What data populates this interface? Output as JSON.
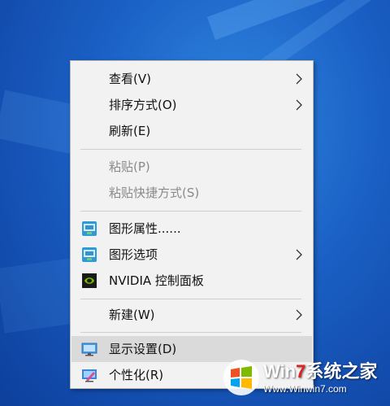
{
  "context_menu": {
    "items": [
      {
        "label": "查看(V)",
        "submenu": true,
        "enabled": true
      },
      {
        "label": "排序方式(O)",
        "submenu": true,
        "enabled": true
      },
      {
        "label": "刷新(E)",
        "submenu": false,
        "enabled": true
      },
      {
        "label": "粘贴(P)",
        "submenu": false,
        "enabled": false
      },
      {
        "label": "粘贴快捷方式(S)",
        "submenu": false,
        "enabled": false
      },
      {
        "label": "图形属性......",
        "submenu": false,
        "enabled": true,
        "icon": "intel-graphics-icon"
      },
      {
        "label": "图形选项",
        "submenu": true,
        "enabled": true,
        "icon": "intel-graphics-icon"
      },
      {
        "label": "NVIDIA 控制面板",
        "submenu": false,
        "enabled": true,
        "icon": "nvidia-icon"
      },
      {
        "label": "新建(W)",
        "submenu": true,
        "enabled": true
      },
      {
        "label": "显示设置(D)",
        "submenu": false,
        "enabled": true,
        "icon": "monitor-icon",
        "highlighted": true
      },
      {
        "label": "个性化(R)",
        "submenu": false,
        "enabled": true,
        "icon": "personalize-icon"
      }
    ]
  },
  "watermark": {
    "title_part1": "Win",
    "title_accent": "7",
    "title_part2": "系统之家",
    "url": "Www.Winwin7.com"
  },
  "colors": {
    "menu_bg": "#f2f2f2",
    "highlight_bg": "#dadada",
    "disabled_text": "#8a8a8a",
    "desktop_blue": "#1a5fc4"
  }
}
